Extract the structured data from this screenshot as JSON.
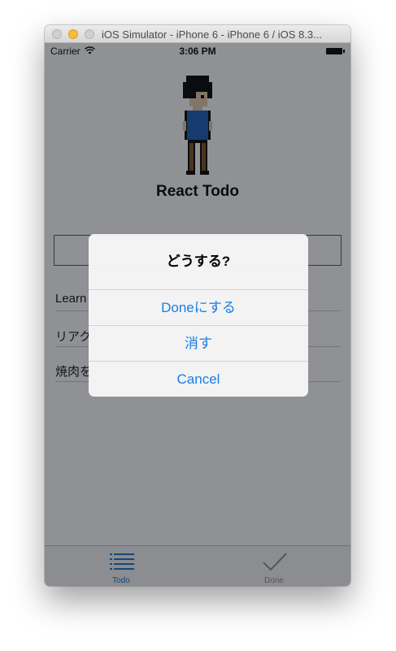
{
  "window": {
    "title": "iOS Simulator - iPhone 6 - iPhone 6 / iOS 8.3..."
  },
  "status_bar": {
    "carrier": "Carrier",
    "time": "3:06 PM"
  },
  "app": {
    "title": "React Todo"
  },
  "new_todo": {
    "value": ""
  },
  "todos": [
    {
      "label": "Learn"
    },
    {
      "label": "リアク"
    },
    {
      "label": "焼肉を"
    }
  ],
  "tabs": [
    {
      "label": "Todo",
      "color": "#1a73c9",
      "icon": "list-icon",
      "selected": true
    },
    {
      "label": "Done",
      "color": "#8e8e8e",
      "icon": "checkmark-icon",
      "selected": false
    }
  ],
  "alert": {
    "title": "どうする?",
    "buttons": [
      {
        "label": "Doneにする"
      },
      {
        "label": "消す"
      },
      {
        "label": "Cancel"
      }
    ],
    "button_color": "#1a7ee6"
  }
}
